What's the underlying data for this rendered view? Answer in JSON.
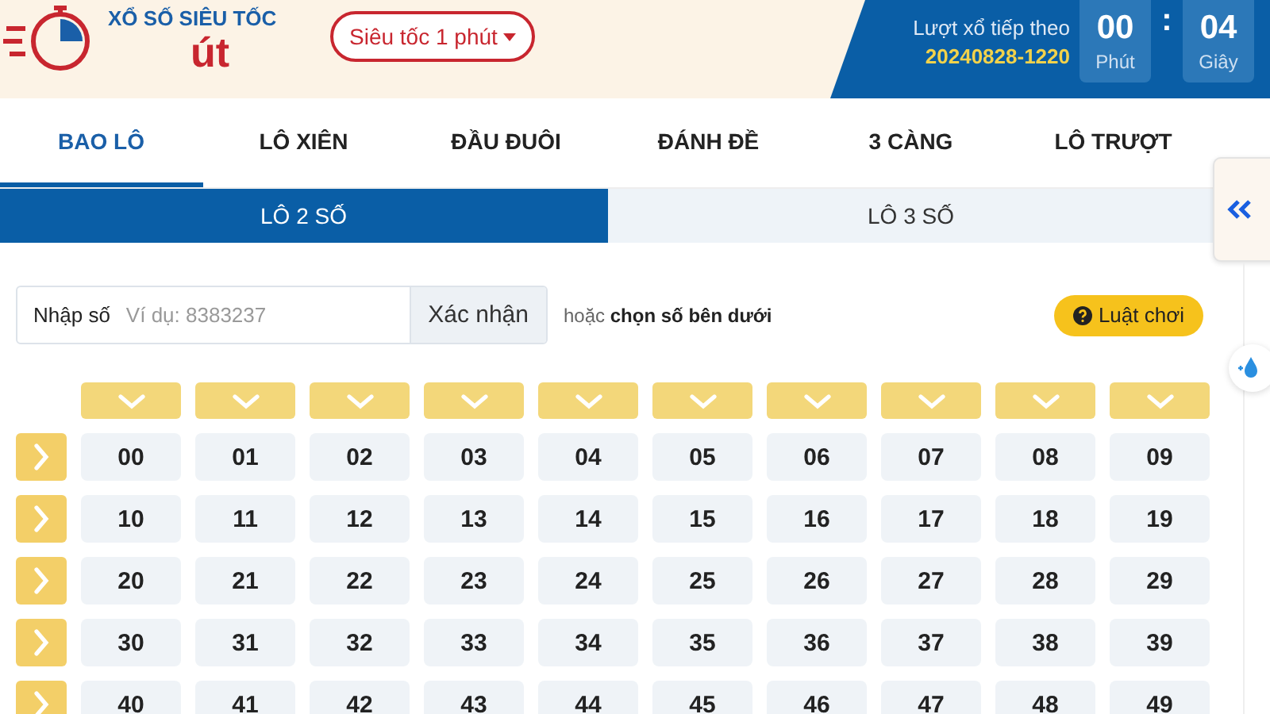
{
  "header": {
    "title": "XỔ SỐ SIÊU TỐC",
    "logo_text": "út",
    "mode_select": {
      "value": "Siêu tốc 1 phút"
    },
    "next_draw": {
      "label": "Lượt xổ tiếp theo",
      "draw_id": "20240828-1220"
    },
    "countdown": [
      {
        "value": "00",
        "unit": "Phút"
      },
      {
        "value": "04",
        "unit": "Giây"
      }
    ],
    "countdown_separator": ":"
  },
  "tabs": [
    {
      "label": "BAO LÔ",
      "selected": true
    },
    {
      "label": "LÔ XIÊN",
      "selected": false
    },
    {
      "label": "ĐẦU ĐUÔI",
      "selected": false
    },
    {
      "label": "ĐÁNH ĐỀ",
      "selected": false
    },
    {
      "label": "3 CÀNG",
      "selected": false
    },
    {
      "label": "LÔ TRƯỢT",
      "selected": false
    }
  ],
  "subtabs": [
    {
      "label": "LÔ 2 SỐ",
      "selected": true
    },
    {
      "label": "LÔ 3 SỐ",
      "selected": false
    }
  ],
  "number_entry": {
    "label": "Nhập số",
    "placeholder": "Ví dụ: 8383237",
    "button": "Xác nhận",
    "hint": "hoặc **chọn số bên dưới**"
  },
  "rules_button": {
    "label": "Luật chơi"
  },
  "number_grid": {
    "rows": [
      [
        "00",
        "01",
        "02",
        "03",
        "04",
        "05",
        "06",
        "07",
        "08",
        "09"
      ],
      [
        "10",
        "11",
        "12",
        "13",
        "14",
        "15",
        "16",
        "17",
        "18",
        "19"
      ],
      [
        "20",
        "21",
        "22",
        "23",
        "24",
        "25",
        "26",
        "27",
        "28",
        "29"
      ],
      [
        "30",
        "31",
        "32",
        "33",
        "34",
        "35",
        "36",
        "37",
        "38",
        "39"
      ],
      [
        "40",
        "41",
        "42",
        "43",
        "44",
        "45",
        "46",
        "47",
        "48",
        "49"
      ]
    ]
  }
}
